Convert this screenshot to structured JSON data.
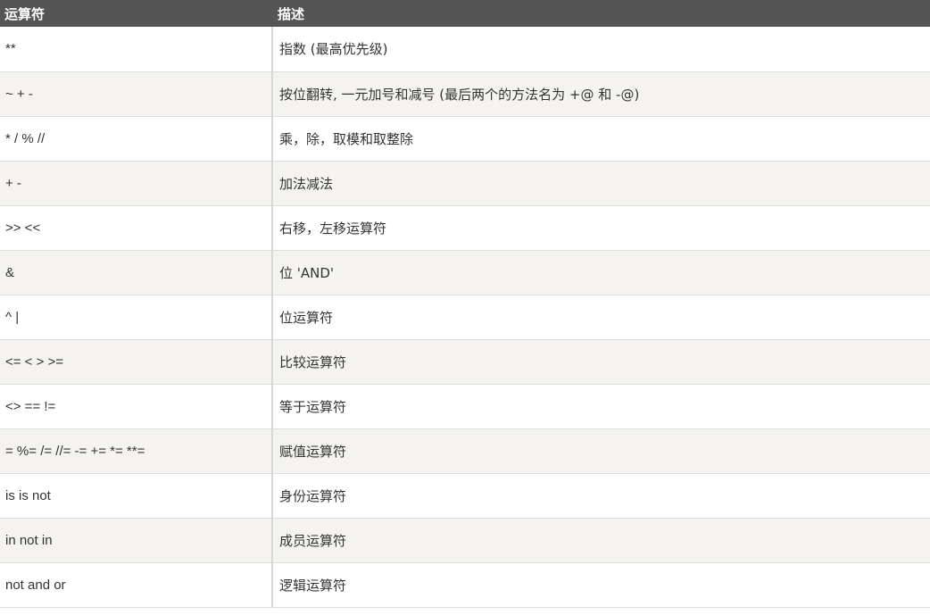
{
  "table": {
    "headers": [
      "运算符",
      "描述"
    ],
    "rows": [
      {
        "operator": "**",
        "description": "指数 (最高优先级)"
      },
      {
        "operator": "~ + -",
        "description": "按位翻转, 一元加号和减号 (最后两个的方法名为 +@ 和 -@)"
      },
      {
        "operator": "* / % //",
        "description": "乘，除，取模和取整除"
      },
      {
        "operator": "+ -",
        "description": "加法减法"
      },
      {
        "operator": ">> <<",
        "description": "右移，左移运算符"
      },
      {
        "operator": "&",
        "description": "位 'AND'"
      },
      {
        "operator": "^ |",
        "description": "位运算符"
      },
      {
        "operator": "<= < > >=",
        "description": "比较运算符"
      },
      {
        "operator": "<> == !=",
        "description": "等于运算符"
      },
      {
        "operator": "= %= /= //= -= += *= **=",
        "description": "赋值运算符"
      },
      {
        "operator": "is is not",
        "description": "身份运算符"
      },
      {
        "operator": "in not in",
        "description": "成员运算符"
      },
      {
        "operator": "not and or",
        "description": "逻辑运算符"
      }
    ]
  },
  "colors": {
    "header_bg": "#555555",
    "header_text": "#ffffff",
    "row_alt_bg": "#f4f3f0",
    "row_bg": "#ffffff",
    "text": "#333333"
  }
}
